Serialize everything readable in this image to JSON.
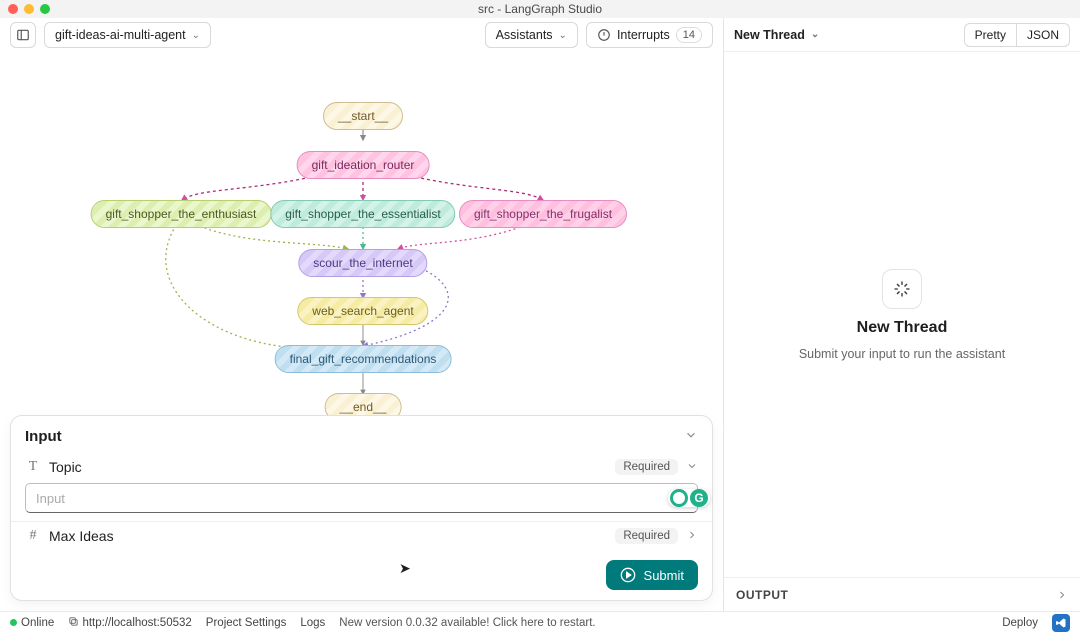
{
  "window": {
    "title": "src - LangGraph Studio"
  },
  "leftBar": {
    "projectDropdown": "gift-ideas-ai-multi-agent",
    "assistants": "Assistants",
    "interrupts": "Interrupts",
    "interruptsCount": "14"
  },
  "graph": {
    "nodes": {
      "start": "__start__",
      "router": "gift_ideation_router",
      "enthusiast": "gift_shopper_the_enthusiast",
      "essentialist": "gift_shopper_the_essentialist",
      "frugalist": "gift_shopper_the_frugalist",
      "scour": "scour_the_internet",
      "web": "web_search_agent",
      "final": "final_gift_recommendations",
      "end": "__end__"
    }
  },
  "inputPanel": {
    "title": "Input",
    "topicLabel": "Topic",
    "topicPlaceholder": "Input",
    "maxIdeasLabel": "Max Ideas",
    "required": "Required",
    "submit": "Submit"
  },
  "rightPane": {
    "newThread": "New Thread",
    "pretty": "Pretty",
    "json": "JSON",
    "emptyTitle": "New Thread",
    "emptySubtitle": "Submit your input to run the assistant",
    "output": "OUTPUT"
  },
  "footer": {
    "online": "Online",
    "url": "http://localhost:50532",
    "projectSettings": "Project Settings",
    "logs": "Logs",
    "update": "New version 0.0.32 available! Click here to restart.",
    "deploy": "Deploy"
  }
}
